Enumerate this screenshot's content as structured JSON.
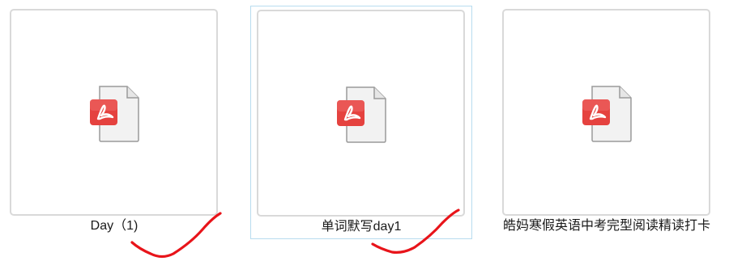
{
  "files": [
    {
      "name": "Day（1)",
      "type": "pdf",
      "icon": "pdf-file-icon",
      "selected": false
    },
    {
      "name": "单词默写day1",
      "type": "pdf",
      "icon": "pdf-file-icon",
      "selected": true
    },
    {
      "name": "皓妈寒假英语中考完型阅读精读打卡",
      "type": "pdf",
      "icon": "pdf-file-icon",
      "selected": false
    }
  ],
  "annotations": [
    {
      "type": "checkmark",
      "color": "#e8141a",
      "target": "Day（1)"
    },
    {
      "type": "checkmark",
      "color": "#e8141a",
      "target": "单词默写day1"
    }
  ],
  "colors": {
    "pdf_badge": "#e5423f",
    "selection_border": "#b8dcef",
    "thumb_border": "#d9d9d9"
  }
}
